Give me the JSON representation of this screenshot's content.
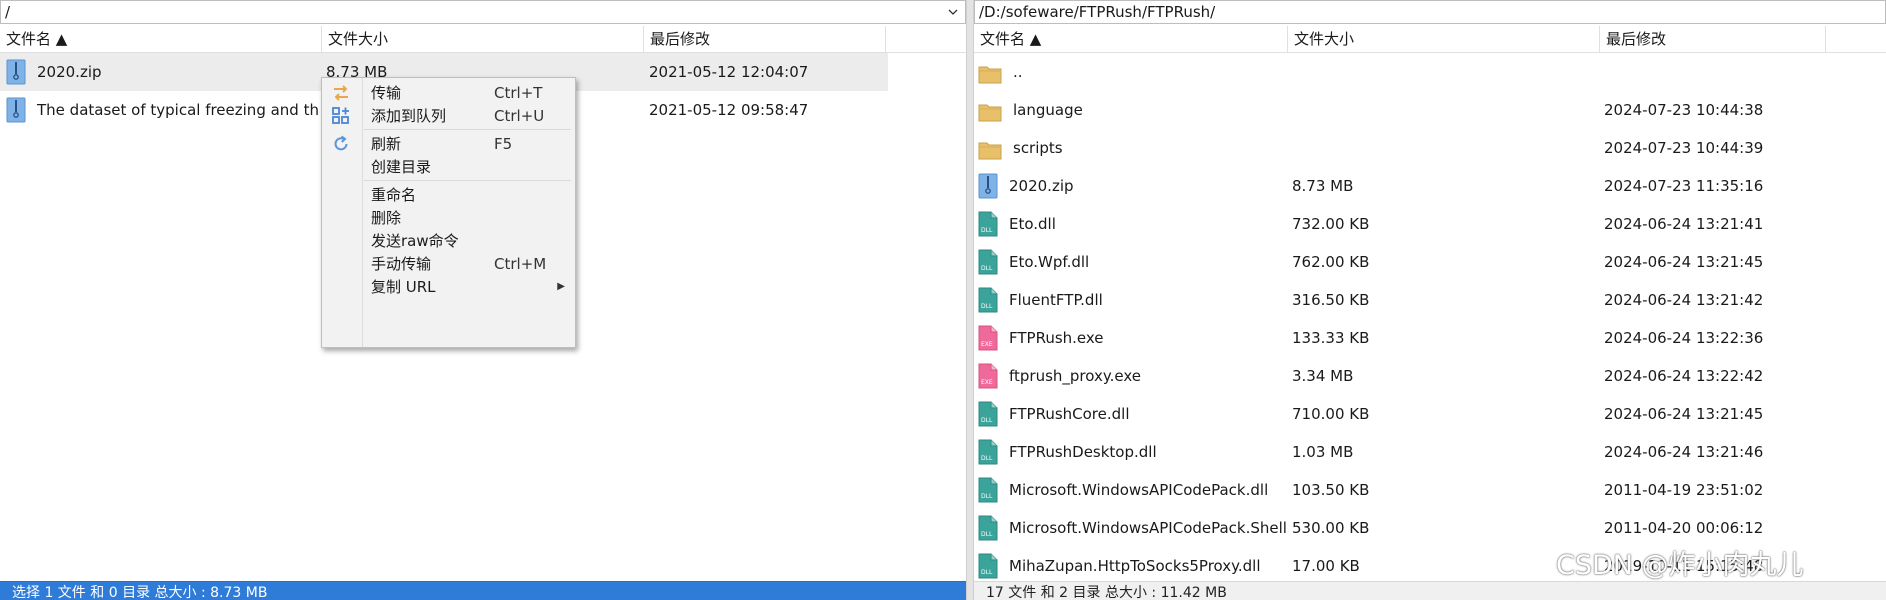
{
  "left_pane": {
    "path": "/",
    "columns": [
      "文件名 ▲",
      "文件大小",
      "最后修改"
    ],
    "rows": [
      {
        "name": "2020.zip",
        "size": "8.73 MB",
        "modified": "2021-05-12 12:04:07",
        "icon": "zip-file-icon"
      },
      {
        "name": "The dataset  of typical freezing and thaw",
        "size": "",
        "modified": "2021-05-12 09:58:47",
        "icon": "zip-file-icon"
      }
    ],
    "status": "选择 1 文件 和 0 目录 总大小 : 8.73 MB"
  },
  "right_pane": {
    "path": "/D:/sofeware/FTPRush/FTPRush/",
    "columns": [
      "文件名 ▲",
      "文件大小",
      "最后修改"
    ],
    "rows": [
      {
        "name": "..",
        "size": "",
        "modified": "",
        "icon": "folder-icon"
      },
      {
        "name": "language",
        "size": "",
        "modified": "2024-07-23 10:44:38",
        "icon": "folder-icon"
      },
      {
        "name": "scripts",
        "size": "",
        "modified": "2024-07-23 10:44:39",
        "icon": "folder-icon"
      },
      {
        "name": "2020.zip",
        "size": "8.73 MB",
        "modified": "2024-07-23 11:35:16",
        "icon": "zip-file-icon"
      },
      {
        "name": "Eto.dll",
        "size": "732.00 KB",
        "modified": "2024-06-24 13:21:41",
        "icon": "dll-file-icon"
      },
      {
        "name": "Eto.Wpf.dll",
        "size": "762.00 KB",
        "modified": "2024-06-24 13:21:45",
        "icon": "dll-file-icon"
      },
      {
        "name": "FluentFTP.dll",
        "size": "316.50 KB",
        "modified": "2024-06-24 13:21:42",
        "icon": "dll-file-icon"
      },
      {
        "name": "FTPRush.exe",
        "size": "133.33 KB",
        "modified": "2024-06-24 13:22:36",
        "icon": "exe-file-icon"
      },
      {
        "name": "ftprush_proxy.exe",
        "size": "3.34 MB",
        "modified": "2024-06-24 13:22:42",
        "icon": "exe-file-icon"
      },
      {
        "name": "FTPRushCore.dll",
        "size": "710.00 KB",
        "modified": "2024-06-24 13:21:45",
        "icon": "dll-file-icon"
      },
      {
        "name": "FTPRushDesktop.dll",
        "size": "1.03 MB",
        "modified": "2024-06-24 13:21:46",
        "icon": "dll-file-icon"
      },
      {
        "name": "Microsoft.WindowsAPICodePack.dll",
        "size": "103.50 KB",
        "modified": "2011-04-19 23:51:02",
        "icon": "dll-file-icon"
      },
      {
        "name": "Microsoft.WindowsAPICodePack.Shell",
        "size": "530.00 KB",
        "modified": "2011-04-20 00:06:12",
        "icon": "dll-file-icon"
      },
      {
        "name": "MihaZupan.HttpToSocks5Proxy.dll",
        "size": "17.00 KB",
        "modified": "2019-10-11 15:15:48",
        "icon": "dll-file-icon"
      }
    ],
    "status": "17 文件 和 2 目录 总大小 : 11.42 MB"
  },
  "context_menu": {
    "items": [
      {
        "label": "传输",
        "shortcut": "Ctrl+T",
        "icon": "transfer-icon"
      },
      {
        "label": "添加到队列",
        "shortcut": "Ctrl+U",
        "icon": "add-to-queue-icon"
      },
      {
        "label": "刷新",
        "shortcut": "F5",
        "icon": "refresh-icon"
      },
      {
        "label": "创建目录",
        "shortcut": ""
      },
      {
        "label": "重命名",
        "shortcut": ""
      },
      {
        "label": "删除",
        "shortcut": ""
      },
      {
        "label": "发送raw命令",
        "shortcut": ""
      },
      {
        "label": "手动传输",
        "shortcut": "Ctrl+M"
      },
      {
        "label": "复制 URL",
        "shortcut": "",
        "submenu": true
      }
    ]
  },
  "watermark": "CSDN @炸小肉丸儿",
  "colors": {
    "status_blue": "#2f7bd8",
    "folder_yellow": "#e8c06a",
    "dll_teal": "#3aa39a",
    "exe_pink": "#ef6a9a",
    "zip_blue": "#7fb3e8"
  }
}
